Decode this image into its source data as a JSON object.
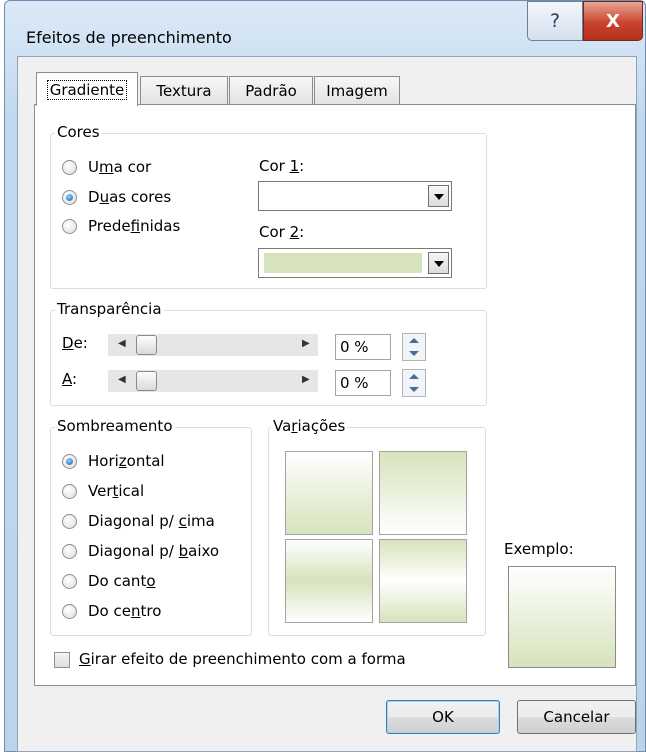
{
  "window": {
    "title": "Efeitos de preenchimento",
    "help_glyph": "?",
    "close_glyph": "X"
  },
  "tabs": [
    {
      "label": "Gradiente",
      "active": true
    },
    {
      "label": "Textura",
      "active": false
    },
    {
      "label": "Padrão",
      "active": false
    },
    {
      "label": "Imagem",
      "active": false
    }
  ],
  "cores": {
    "title": "Cores",
    "options": [
      {
        "pre": "U",
        "u": "m",
        "post": "a cor",
        "checked": false
      },
      {
        "pre": "D",
        "u": "u",
        "post": "as cores",
        "checked": true
      },
      {
        "pre": "Prede",
        "u": "f",
        "post": "inidas",
        "checked": false
      }
    ],
    "cor1": {
      "pre": "Cor ",
      "u": "1",
      "post": ":",
      "color": "#ffffff"
    },
    "cor2": {
      "pre": "Cor ",
      "u": "2",
      "post": ":",
      "color": "#d6e3bc"
    }
  },
  "transparencia": {
    "title": "Transparência",
    "rows": [
      {
        "pre": "",
        "u": "D",
        "post": "e:",
        "value": "0 %",
        "level": 0
      },
      {
        "pre": "",
        "u": "A",
        "post": ":",
        "value": "0 %",
        "level": 0
      }
    ]
  },
  "sombreamento": {
    "title": "Sombreamento",
    "options": [
      {
        "pre": "Hori",
        "u": "z",
        "post": "ontal",
        "checked": true
      },
      {
        "pre": "Ver",
        "u": "t",
        "post": "ical",
        "checked": false
      },
      {
        "pre": "Diagonal p/ ",
        "u": "c",
        "post": "ima",
        "checked": false
      },
      {
        "pre": "Diagonal p/ ",
        "u": "b",
        "post": "aixo",
        "checked": false
      },
      {
        "pre": "Do cant",
        "u": "o",
        "post": "",
        "checked": false
      },
      {
        "pre": "Do ce",
        "u": "n",
        "post": "tro",
        "checked": false
      }
    ]
  },
  "variacoes": {
    "pre": "Va",
    "u": "r",
    "post": "iações"
  },
  "exemplo": {
    "label": "Exemplo:"
  },
  "girar": {
    "pre": "",
    "u": "G",
    "post": "irar efeito de preenchimento com a forma",
    "checked": false
  },
  "buttons": {
    "ok": "OK",
    "cancel": "Cancelar"
  },
  "colors": {
    "gradient_light": "#ffffff",
    "gradient_green": "#d6e3bc",
    "accent_blue": "#3c7fb1"
  }
}
